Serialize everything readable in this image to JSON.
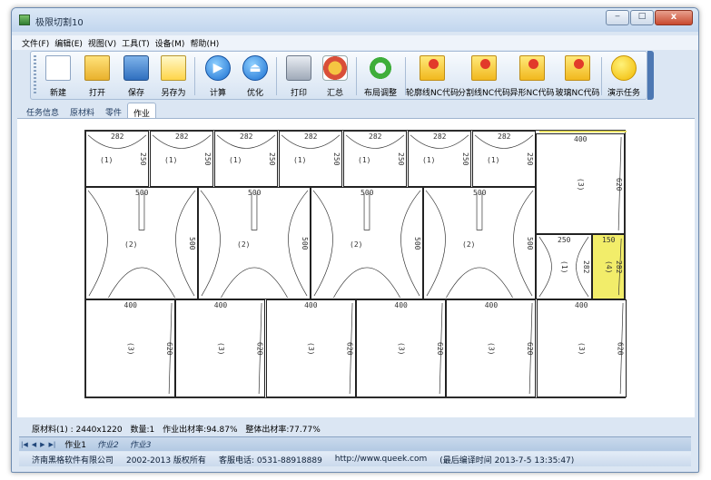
{
  "window": {
    "title": "极限切割10"
  },
  "menu": [
    "文件(F)",
    "编辑(E)",
    "视图(V)",
    "工具(T)",
    "设备(M)",
    "帮助(H)"
  ],
  "toolbar": [
    {
      "label": "新建",
      "icon": "new-document-icon"
    },
    {
      "label": "打开",
      "icon": "open-folder-icon"
    },
    {
      "label": "保存",
      "icon": "save-icon"
    },
    {
      "label": "另存为",
      "icon": "save-as-icon"
    },
    {
      "label": "计算",
      "icon": "play-icon"
    },
    {
      "label": "优化",
      "icon": "optimize-icon"
    },
    {
      "label": "打印",
      "icon": "printer-icon"
    },
    {
      "label": "汇总",
      "icon": "summary-chart-icon"
    },
    {
      "label": "布局调整",
      "icon": "refresh-icon"
    },
    {
      "label": "轮廓线NC代码",
      "icon": "pin-icon"
    },
    {
      "label": "分割线NC代码",
      "icon": "pin-icon"
    },
    {
      "label": "异形NC代码",
      "icon": "pin-icon"
    },
    {
      "label": "玻璃NC代码",
      "icon": "pin-icon"
    },
    {
      "label": "演示任务",
      "icon": "smiley-icon"
    }
  ],
  "tabs": [
    "任务信息",
    "原材料",
    "零件",
    "作业"
  ],
  "active_tab": "作业",
  "layout": {
    "small_parts": {
      "top_label": "282",
      "side_label": "250",
      "tag": "(1)",
      "count": 7
    },
    "large_parts": {
      "top_label": "500",
      "side_label": "500",
      "tag": "(2)",
      "count": 4
    },
    "right_top_part": {
      "top_label": "400",
      "side_label": "620",
      "tag": "(3)"
    },
    "right_mid_left": {
      "top_label": "250",
      "side_label": "282",
      "tag": "(1)"
    },
    "right_mid_right": {
      "top_label": "150",
      "side_label": "282",
      "tag": "(4)",
      "highlight": "#f2ed6a"
    },
    "bottom_parts": {
      "top_label": "400",
      "side_label": "620",
      "tag": "(3)",
      "count": 6
    }
  },
  "info": {
    "material": "原材料(1) : 2440x1220",
    "quantity": "数量:1",
    "job_rate": "作业出材率:94.87%",
    "overall_rate": "整体出材率:77.77%"
  },
  "bottom_tabs": [
    "作业1",
    "作业2",
    "作业3"
  ],
  "active_bottom_tab": "作业1",
  "status": {
    "company": "济南黑格软件有限公司",
    "copyright": "2002-2013 版权所有",
    "phone": "客服电话: 0531-88918889",
    "url": "http://www.queek.com",
    "build": "(最后编译时间 2013-7-5 13:35:47)"
  },
  "colors": {
    "accent": "#4d78b3",
    "highlight": "#f2ed6a",
    "strip": "#e8df62"
  }
}
